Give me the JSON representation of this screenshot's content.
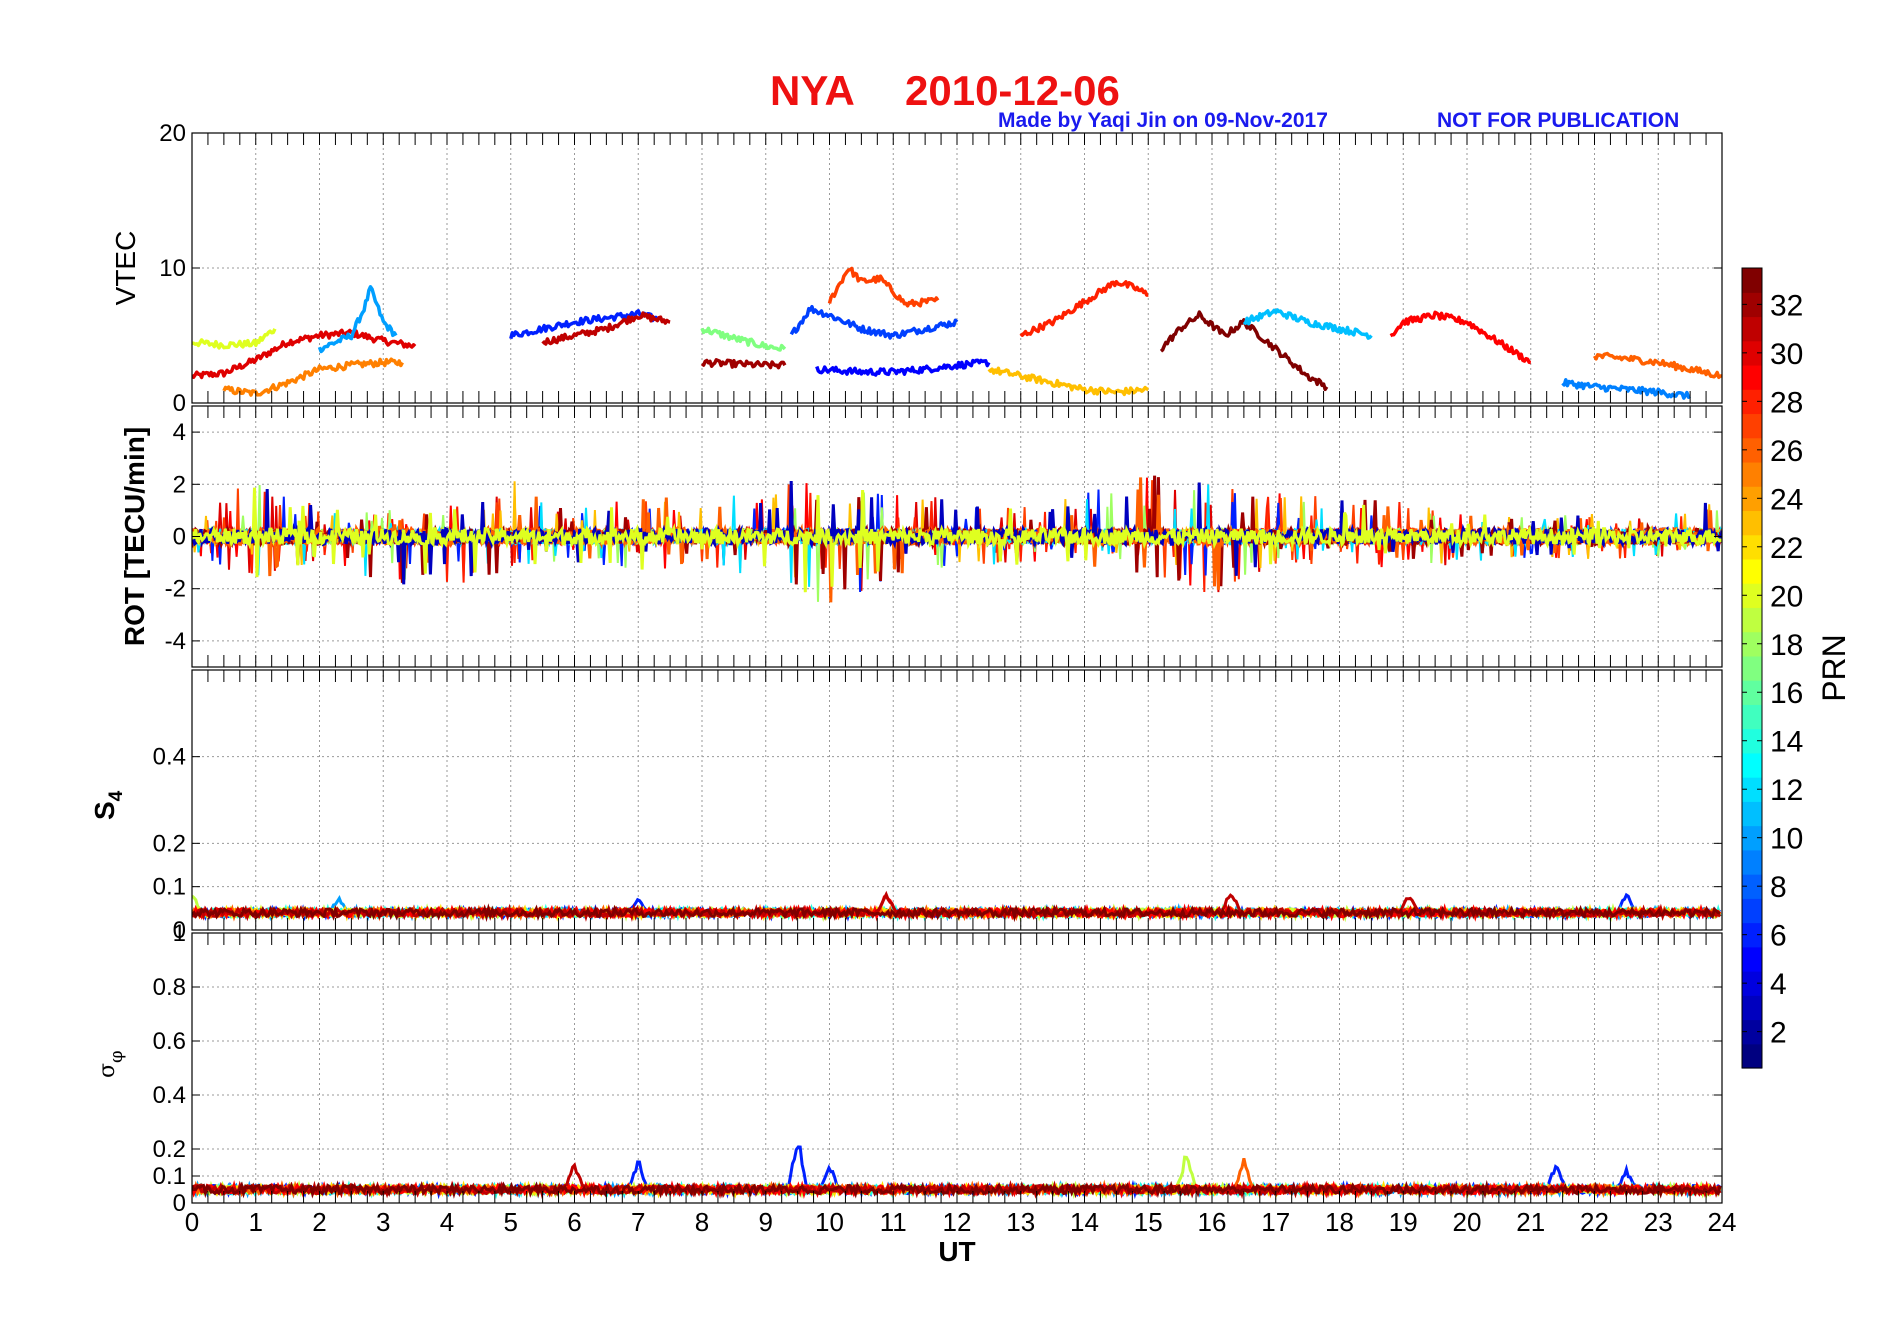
{
  "figure": {
    "title_station": "NYA",
    "title_date": "2010-12-06",
    "credit": "Made by Yaqi Jin on 09-Nov-2017",
    "notice": "NOT FOR PUBLICATION",
    "title_color": "#ee1111",
    "credit_color": "#1a1aee"
  },
  "chart_data": [
    {
      "type": "line",
      "panel": "VTEC",
      "ylabel": "VTEC",
      "xlabel": "",
      "xlim": [
        0,
        24
      ],
      "ylim": [
        0,
        20
      ],
      "yticks": [
        0,
        10,
        20
      ],
      "ytick_labels": [
        "0",
        "10",
        "20"
      ],
      "grid": true,
      "series_color_by": "PRN",
      "series": [
        {
          "prn": 30,
          "x": [
            0,
            0.5,
            1,
            1.5,
            2,
            2.5,
            3,
            3.5
          ],
          "y": [
            2.0,
            2.2,
            3.2,
            4.5,
            5.0,
            5.2,
            4.6,
            4.2
          ]
        },
        {
          "prn": 20,
          "x": [
            0,
            0.5,
            1,
            1.3
          ],
          "y": [
            4.5,
            4.3,
            4.4,
            5.5
          ]
        },
        {
          "prn": 10,
          "x": [
            2,
            2.5,
            2.7,
            2.8,
            3,
            3.2
          ],
          "y": [
            4.0,
            5.0,
            7.0,
            8.5,
            6.0,
            5.0
          ]
        },
        {
          "prn": 25,
          "x": [
            0.5,
            1,
            1.5,
            2,
            2.5,
            3,
            3.3
          ],
          "y": [
            1.0,
            0.7,
            1.5,
            2.5,
            2.8,
            3.0,
            3.0
          ]
        },
        {
          "prn": 6,
          "x": [
            5,
            5.5,
            6,
            6.5,
            7,
            7.3
          ],
          "y": [
            5.0,
            5.5,
            6.0,
            6.3,
            6.6,
            6.2
          ]
        },
        {
          "prn": 31,
          "x": [
            5.5,
            6,
            6.5,
            7,
            7.5
          ],
          "y": [
            4.5,
            5.0,
            5.5,
            6.5,
            6.0
          ]
        },
        {
          "prn": 17,
          "x": [
            8,
            8.5,
            9,
            9.3
          ],
          "y": [
            5.5,
            4.8,
            4.2,
            4.0
          ]
        },
        {
          "prn": 32,
          "x": [
            8,
            8.5,
            9,
            9.3
          ],
          "y": [
            3.0,
            2.9,
            2.8,
            2.8
          ]
        },
        {
          "prn": 27,
          "x": [
            10,
            10.3,
            10.5,
            10.8,
            11.2,
            11.7
          ],
          "y": [
            7.5,
            10.0,
            9.0,
            9.2,
            7.3,
            7.6
          ]
        },
        {
          "prn": 7,
          "x": [
            9.4,
            9.7,
            10,
            10.5,
            11,
            11.5,
            12
          ],
          "y": [
            5.0,
            7.0,
            6.5,
            5.5,
            5.0,
            5.5,
            6.0
          ]
        },
        {
          "prn": 5,
          "x": [
            9.8,
            10.5,
            11,
            11.5,
            12,
            12.5
          ],
          "y": [
            2.5,
            2.3,
            2.3,
            2.5,
            2.8,
            3.0
          ]
        },
        {
          "prn": 23,
          "x": [
            12.5,
            13,
            13.5,
            14,
            14.5,
            15
          ],
          "y": [
            2.5,
            2.0,
            1.5,
            1.0,
            0.8,
            1.0
          ]
        },
        {
          "prn": 28,
          "x": [
            13,
            13.5,
            14,
            14.5,
            14.8,
            15
          ],
          "y": [
            5.0,
            6.0,
            7.5,
            9.0,
            8.5,
            8.0
          ]
        },
        {
          "prn": 33,
          "x": [
            15.2,
            15.5,
            15.8,
            16.2,
            16.5,
            17,
            17.5,
            17.8
          ],
          "y": [
            4.0,
            5.5,
            6.5,
            5.0,
            6.0,
            4.0,
            2.0,
            1.2
          ]
        },
        {
          "prn": 11,
          "x": [
            16.5,
            17,
            17.5,
            18,
            18.5
          ],
          "y": [
            6.0,
            6.8,
            6.0,
            5.5,
            5.0
          ]
        },
        {
          "prn": 29,
          "x": [
            18.8,
            19,
            19.5,
            20,
            20.5,
            21
          ],
          "y": [
            5.0,
            6.0,
            6.5,
            6.0,
            4.5,
            3.0
          ]
        },
        {
          "prn": 9,
          "x": [
            21.5,
            22,
            22.5,
            23,
            23.5
          ],
          "y": [
            1.5,
            1.2,
            1.0,
            0.8,
            0.5
          ]
        },
        {
          "prn": 26,
          "x": [
            22,
            22.5,
            23,
            23.5,
            24
          ],
          "y": [
            3.5,
            3.3,
            3.0,
            2.5,
            2.0
          ]
        }
      ]
    },
    {
      "type": "line",
      "panel": "ROT",
      "ylabel": "ROT [TECU/min]",
      "xlabel": "",
      "xlim": [
        0,
        24
      ],
      "ylim": [
        -5,
        5
      ],
      "yticks": [
        -4,
        -2,
        0,
        2,
        4
      ],
      "ytick_labels": [
        "-4",
        "-2",
        "0",
        "2",
        "4"
      ],
      "grid": true,
      "envelope_by_hour": {
        "hours": [
          0,
          1,
          2,
          3,
          4,
          5,
          6,
          7,
          8,
          9,
          10,
          11,
          12,
          13,
          14,
          15,
          16,
          17,
          18,
          19,
          20,
          21,
          22,
          23,
          24
        ],
        "upper": [
          0.7,
          2.3,
          1.1,
          1.0,
          1.2,
          2.2,
          1.0,
          1.6,
          1.4,
          2.3,
          1.9,
          1.7,
          1.6,
          1.2,
          1.7,
          2.5,
          2.4,
          1.8,
          1.5,
          1.4,
          1.1,
          0.8,
          0.9,
          0.6,
          1.8
        ],
        "lower": [
          -0.7,
          -1.7,
          -0.9,
          -1.8,
          -2.2,
          -1.3,
          -1.0,
          -1.3,
          -1.2,
          -1.8,
          -2.9,
          -1.5,
          -1.2,
          -1.2,
          -1.2,
          -1.5,
          -2.3,
          -1.1,
          -1.1,
          -1.3,
          -1.0,
          -0.8,
          -0.9,
          -0.8,
          -0.6
        ]
      }
    },
    {
      "type": "line",
      "panel": "S4",
      "ylabel": "S4",
      "xlabel": "",
      "xlim": [
        0,
        24
      ],
      "ylim": [
        0,
        0.6
      ],
      "yticks": [
        0,
        0.1,
        0.2,
        0.4
      ],
      "ytick_labels": [
        "0",
        "0.1",
        "0.2",
        "0.4"
      ],
      "grid": true,
      "baseline": 0.04,
      "peaks": [
        {
          "x": 0.0,
          "y": 0.09,
          "prn": 19
        },
        {
          "x": 2.3,
          "y": 0.08,
          "prn": 10
        },
        {
          "x": 7.0,
          "y": 0.08,
          "prn": 5
        },
        {
          "x": 7.9,
          "y": 0.1,
          "prn": 12
        },
        {
          "x": 10.9,
          "y": 0.09,
          "prn": 30
        },
        {
          "x": 14.0,
          "y": 0.08,
          "prn": 8
        },
        {
          "x": 15.7,
          "y": 0.11,
          "prn": 12
        },
        {
          "x": 16.3,
          "y": 0.1,
          "prn": 31
        },
        {
          "x": 19.1,
          "y": 0.09,
          "prn": 31
        },
        {
          "x": 22.5,
          "y": 0.09,
          "prn": 6
        }
      ]
    },
    {
      "type": "line",
      "panel": "sigma_phi",
      "ylabel": "σφ",
      "xlabel": "UT",
      "xlim": [
        0,
        24
      ],
      "ylim": [
        0,
        1
      ],
      "yticks": [
        0,
        0.1,
        0.2,
        0.4,
        0.6,
        0.8,
        1
      ],
      "ytick_labels": [
        "0",
        "0.1",
        "0.2",
        "0.4",
        "0.6",
        "0.8",
        "1"
      ],
      "xticks": [
        0,
        1,
        2,
        3,
        4,
        5,
        6,
        7,
        8,
        9,
        10,
        11,
        12,
        13,
        14,
        15,
        16,
        17,
        18,
        19,
        20,
        21,
        22,
        23,
        24
      ],
      "xtick_labels": [
        "0",
        "1",
        "2",
        "3",
        "4",
        "5",
        "6",
        "7",
        "8",
        "9",
        "10",
        "11",
        "12",
        "13",
        "14",
        "15",
        "16",
        "17",
        "18",
        "19",
        "20",
        "21",
        "22",
        "23",
        "24"
      ],
      "grid": true,
      "baseline": 0.05,
      "peaks": [
        {
          "x": 6.0,
          "y": 0.16,
          "prn": 31
        },
        {
          "x": 7.0,
          "y": 0.17,
          "prn": 5
        },
        {
          "x": 9.5,
          "y": 0.27,
          "prn": 6
        },
        {
          "x": 10.0,
          "y": 0.15,
          "prn": 6
        },
        {
          "x": 15.6,
          "y": 0.2,
          "prn": 19
        },
        {
          "x": 16.5,
          "y": 0.17,
          "prn": 27
        },
        {
          "x": 21.4,
          "y": 0.16,
          "prn": 6
        },
        {
          "x": 22.5,
          "y": 0.13,
          "prn": 6
        }
      ]
    }
  ],
  "colorbar": {
    "label": "PRN",
    "range": [
      1,
      33
    ],
    "ticks": [
      "2",
      "4",
      "6",
      "8",
      "10",
      "12",
      "14",
      "16",
      "18",
      "20",
      "22",
      "24",
      "26",
      "28",
      "30",
      "32"
    ],
    "colormap": "jet"
  }
}
